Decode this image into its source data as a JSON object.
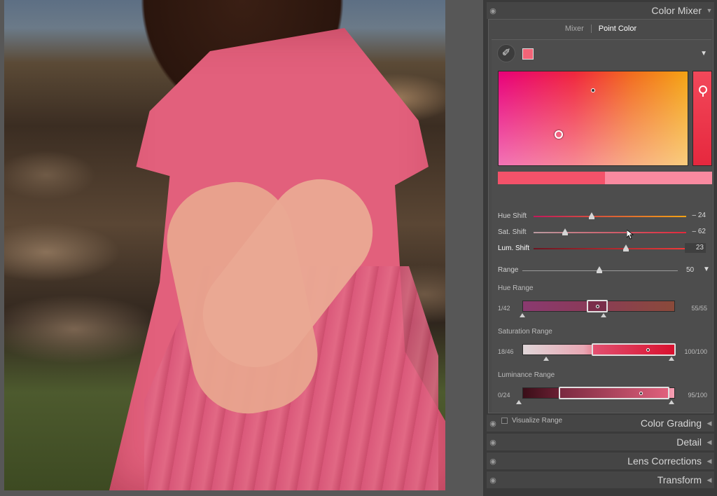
{
  "sidebar": {
    "panels": [
      {
        "title": "Color Mixer"
      },
      {
        "title": "Color Grading"
      },
      {
        "title": "Detail"
      },
      {
        "title": "Lens Corrections"
      },
      {
        "title": "Transform"
      }
    ]
  },
  "color_mixer": {
    "tabs": [
      {
        "label": "Mixer",
        "active": false
      },
      {
        "label": "Point Color",
        "active": true
      }
    ],
    "selected_color": "#f26477",
    "sliders": [
      {
        "label": "Hue Shift",
        "value": "– 24"
      },
      {
        "label": "Sat. Shift",
        "value": "– 62"
      },
      {
        "label": "Lum. Shift",
        "value": "23"
      }
    ],
    "range": {
      "label": "Range",
      "value": "50"
    },
    "hue_range": {
      "label": "Hue Range",
      "low": "1/42",
      "high": "55/55"
    },
    "saturation_range": {
      "label": "Saturation Range",
      "low": "18/46",
      "high": "100/100"
    },
    "luminance_range": {
      "label": "Luminance Range",
      "low": "0/24",
      "high": "95/100"
    },
    "visualize_range": {
      "label": "Visualize Range",
      "checked": false
    }
  },
  "icons": {
    "eye": "eye-icon",
    "eyedropper": "eyedropper-icon",
    "collapse": "collapse-triangle-icon"
  }
}
